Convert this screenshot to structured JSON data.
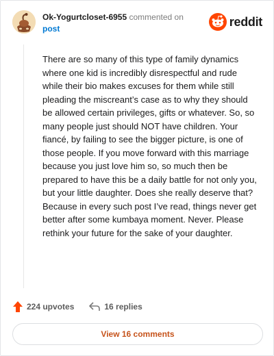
{
  "comment": {
    "username": "Ok-Yogurtcloset-6955",
    "action": "commented on",
    "post_link": "post",
    "brand": "reddit",
    "body": "There are so many of this type of family dynamics where one kid is incredibly disrespectful and rude while their bio makes excuses for them while still pleading the miscreant’s case as to why they should be allowed certain privileges, gifts or whatever. So, so many people just should NOT have children. Your fiancé, by failing to see the bigger picture, is one of those people. If you move forward with this marriage because you just love him so, so much then be prepared to have this be a daily battle for not only you, but your little daughter. Does she really deserve that? Because in every such post I’ve read, things never get better after some kumbaya moment. Never. Please rethink your future for the sake of your daughter.",
    "upvotes": "224 upvotes",
    "replies": "16 replies",
    "view_comments": "View 16 comments"
  },
  "icons": {
    "avatar": "snoo-avatar",
    "brand_logo": "reddit-logo-icon",
    "upvote": "upvote-arrow-icon",
    "reply": "reply-arrow-icon"
  },
  "colors": {
    "accent_orange": "#ff4500",
    "link_blue": "#0079d3",
    "button_text": "#c6531b",
    "border": "#e3e5e8"
  }
}
